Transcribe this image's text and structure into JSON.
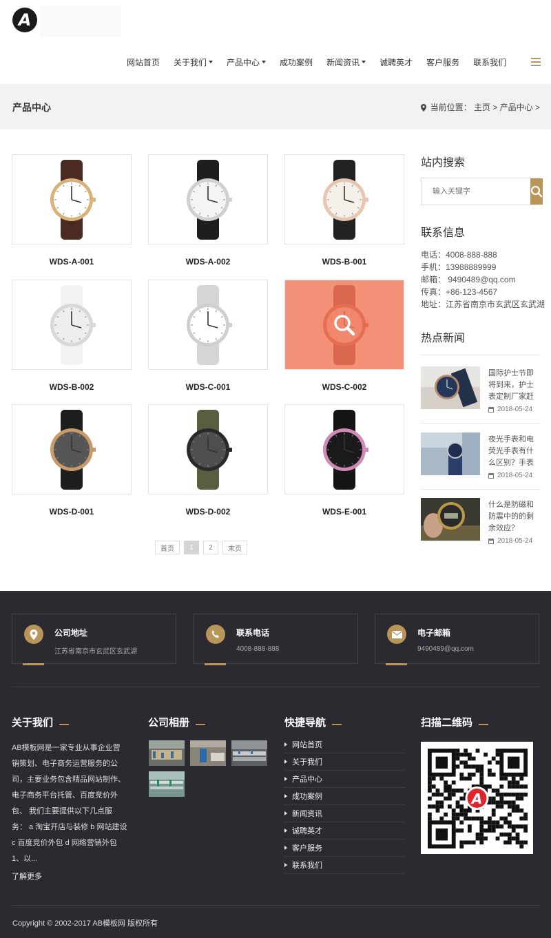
{
  "header": {
    "logo_letter": "A",
    "nav": [
      {
        "label": "网站首页",
        "has_dropdown": false
      },
      {
        "label": "关于我们",
        "has_dropdown": true
      },
      {
        "label": "产品中心",
        "has_dropdown": true
      },
      {
        "label": "成功案例",
        "has_dropdown": false
      },
      {
        "label": "新闻资讯",
        "has_dropdown": true
      },
      {
        "label": "诚聘英才",
        "has_dropdown": false
      },
      {
        "label": "客户服务",
        "has_dropdown": false
      },
      {
        "label": "联系我们",
        "has_dropdown": false
      }
    ],
    "accent_color": "#b8965a"
  },
  "banner": {
    "title": "产品中心",
    "breadcrumb": "当前位置： 主页 > 产品中心 >"
  },
  "products": [
    {
      "name": "WDS-A-001",
      "strap": "#4a2a22",
      "case": "#d9b27a",
      "dial": "#ffffff"
    },
    {
      "name": "WDS-A-002",
      "strap": "#1e1e1e",
      "case": "#d0d0d0",
      "dial": "#f4f4f4"
    },
    {
      "name": "WDS-B-001",
      "strap": "#222222",
      "case": "#e6c6b0",
      "dial": "#f6f0ea"
    },
    {
      "name": "WDS-B-002",
      "strap": "#f2f2f2",
      "case": "#d8d8d8",
      "dial": "#eeeeee"
    },
    {
      "name": "WDS-C-001",
      "strap": "#d5d5d5",
      "case": "#cfcfcf",
      "dial": "#ffffff"
    },
    {
      "name": "WDS-C-002",
      "strap": "#7a2418",
      "case": "#b04030",
      "dial": "#f0d0c8",
      "hover": true
    },
    {
      "name": "WDS-D-001",
      "strap": "#1e1e1e",
      "case": "#c99a6a",
      "dial": "#555555"
    },
    {
      "name": "WDS-D-002",
      "strap": "#5a5e40",
      "case": "#2a2a2a",
      "dial": "#4e4e4e"
    },
    {
      "name": "WDS-E-001",
      "strap": "#151515",
      "case": "#d08ab8",
      "dial": "#1a1a1a"
    }
  ],
  "pager": [
    "首页",
    "1",
    "2",
    "末页"
  ],
  "sidebar": {
    "search_heading": "站内搜索",
    "search_placeholder": "输入关键字",
    "contact_heading": "联系信息",
    "contact": [
      "电话：4008-888-888",
      "手机：13988889999",
      "邮箱： 9490489@qq.com",
      "传真：+86-123-4567",
      "地址：江苏省南京市玄武区玄武湖"
    ],
    "news_heading": "热点新闻",
    "news": [
      {
        "title": "国际护士节即将到来，护士表定制厂家赶",
        "date": "2018-05-24"
      },
      {
        "title": "夜光手表和电荧光手表有什么区别？手表",
        "date": "2018-05-24"
      },
      {
        "title": "什么是防磁和防震中的的剩余效应？",
        "date": "2018-05-24"
      }
    ]
  },
  "footer": {
    "info": [
      {
        "title": "公司地址",
        "text": "江苏省南京市玄武区玄武湖",
        "icon": "location-icon"
      },
      {
        "title": "联系电话",
        "text": "4008-888-888",
        "icon": "phone-icon"
      },
      {
        "title": "电子邮箱",
        "text": "9490489@qq.com",
        "icon": "mail-icon"
      }
    ],
    "about_heading": "关于我们",
    "about_text": "AB模板网是一家专业从事企业营销策划、电子商务运营服务的公司，主要业务包含精品网站制作、电子商务平台托管、百度竞价外包、 我们主要提供以下几点服务： a 淘宝开店与装修 b 网站建设 c 百度竞价外包 d 网络营销外包 1、以...",
    "about_more": "了解更多",
    "album_heading": "公司相册",
    "quick_heading": "快捷导航",
    "quick": [
      "网站首页",
      "关于我们",
      "产品中心",
      "成功案例",
      "新闻资讯",
      "诚聘英才",
      "客户服务",
      "联系我们"
    ],
    "qr_heading": "扫描二维码",
    "copyright": "Copyright © 2002-2017 AB模板网 版权所有"
  }
}
